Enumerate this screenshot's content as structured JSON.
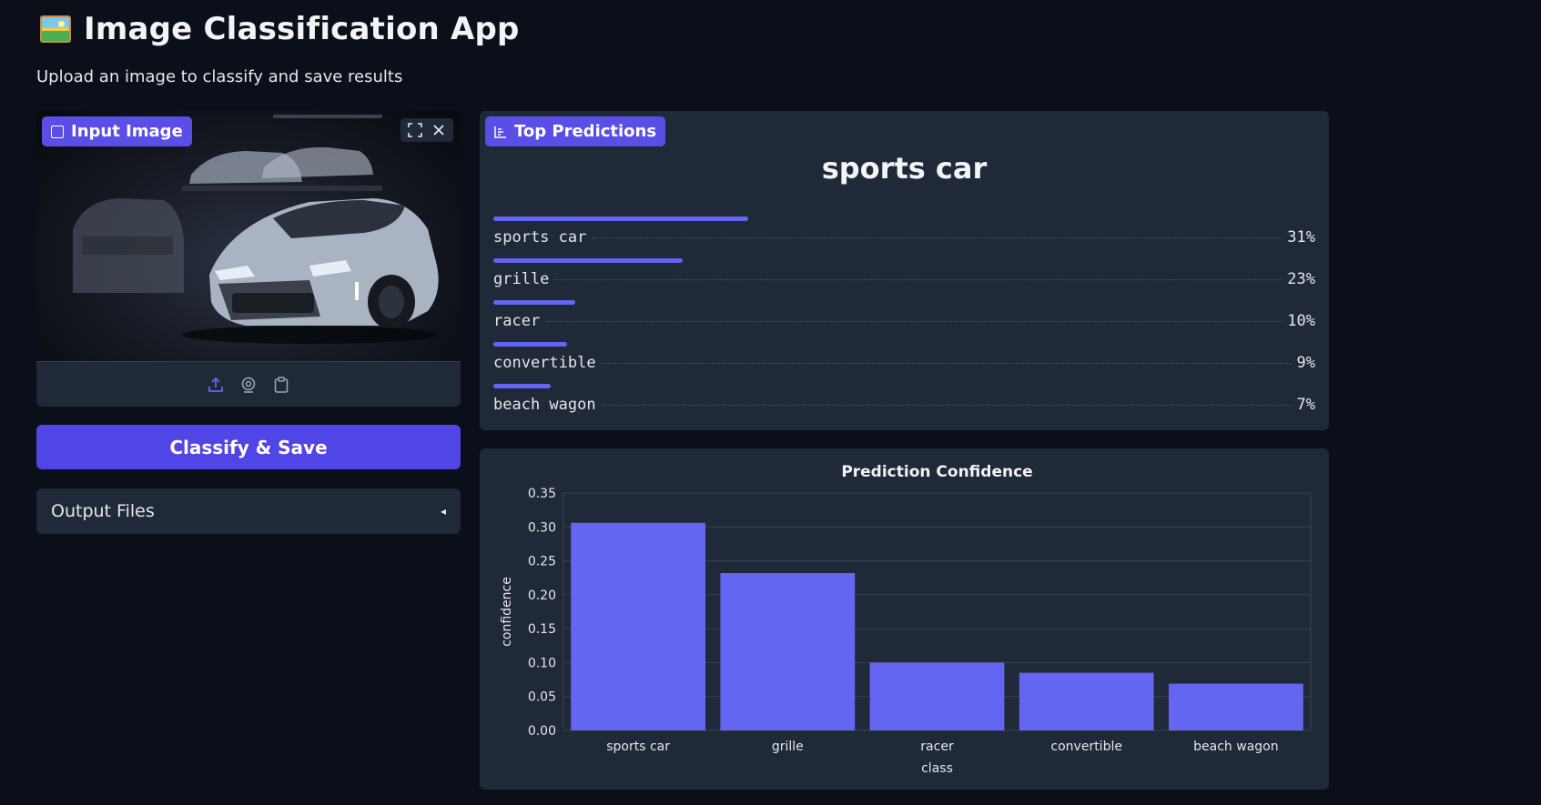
{
  "header": {
    "title": "Image Classification App",
    "subtitle": "Upload an image to classify and save results"
  },
  "input_panel": {
    "label": "Input Image",
    "tools": [
      "fullscreen-icon",
      "close-icon"
    ],
    "footer_icons": [
      "upload-icon",
      "webcam-icon",
      "clipboard-icon"
    ]
  },
  "classify_button": {
    "label": "Classify & Save"
  },
  "output_files": {
    "label": "Output Files",
    "arrow": "◂"
  },
  "predictions": {
    "label": "Top Predictions",
    "top_label": "sports car",
    "items": [
      {
        "label": "sports car",
        "confidence": 0.31,
        "percent": "31%"
      },
      {
        "label": "grille",
        "confidence": 0.23,
        "percent": "23%"
      },
      {
        "label": "racer",
        "confidence": 0.1,
        "percent": "10%"
      },
      {
        "label": "convertible",
        "confidence": 0.09,
        "percent": "9%"
      },
      {
        "label": "beach wagon",
        "confidence": 0.07,
        "percent": "7%"
      }
    ]
  },
  "chart_data": {
    "type": "bar",
    "title": "Prediction Confidence",
    "xlabel": "class",
    "ylabel": "confidence",
    "categories": [
      "sports car",
      "grille",
      "racer",
      "convertible",
      "beach wagon"
    ],
    "values": [
      0.306,
      0.232,
      0.1,
      0.085,
      0.069
    ],
    "ylim": [
      0,
      0.35
    ],
    "yticks": [
      "0.00",
      "0.05",
      "0.10",
      "0.15",
      "0.20",
      "0.25",
      "0.30",
      "0.35"
    ],
    "grid": true,
    "bar_color": "#6366f1"
  },
  "colors": {
    "background": "#0b0f19",
    "panel": "#1f2937",
    "accent": "#5145e5",
    "bar": "#6366f1"
  }
}
